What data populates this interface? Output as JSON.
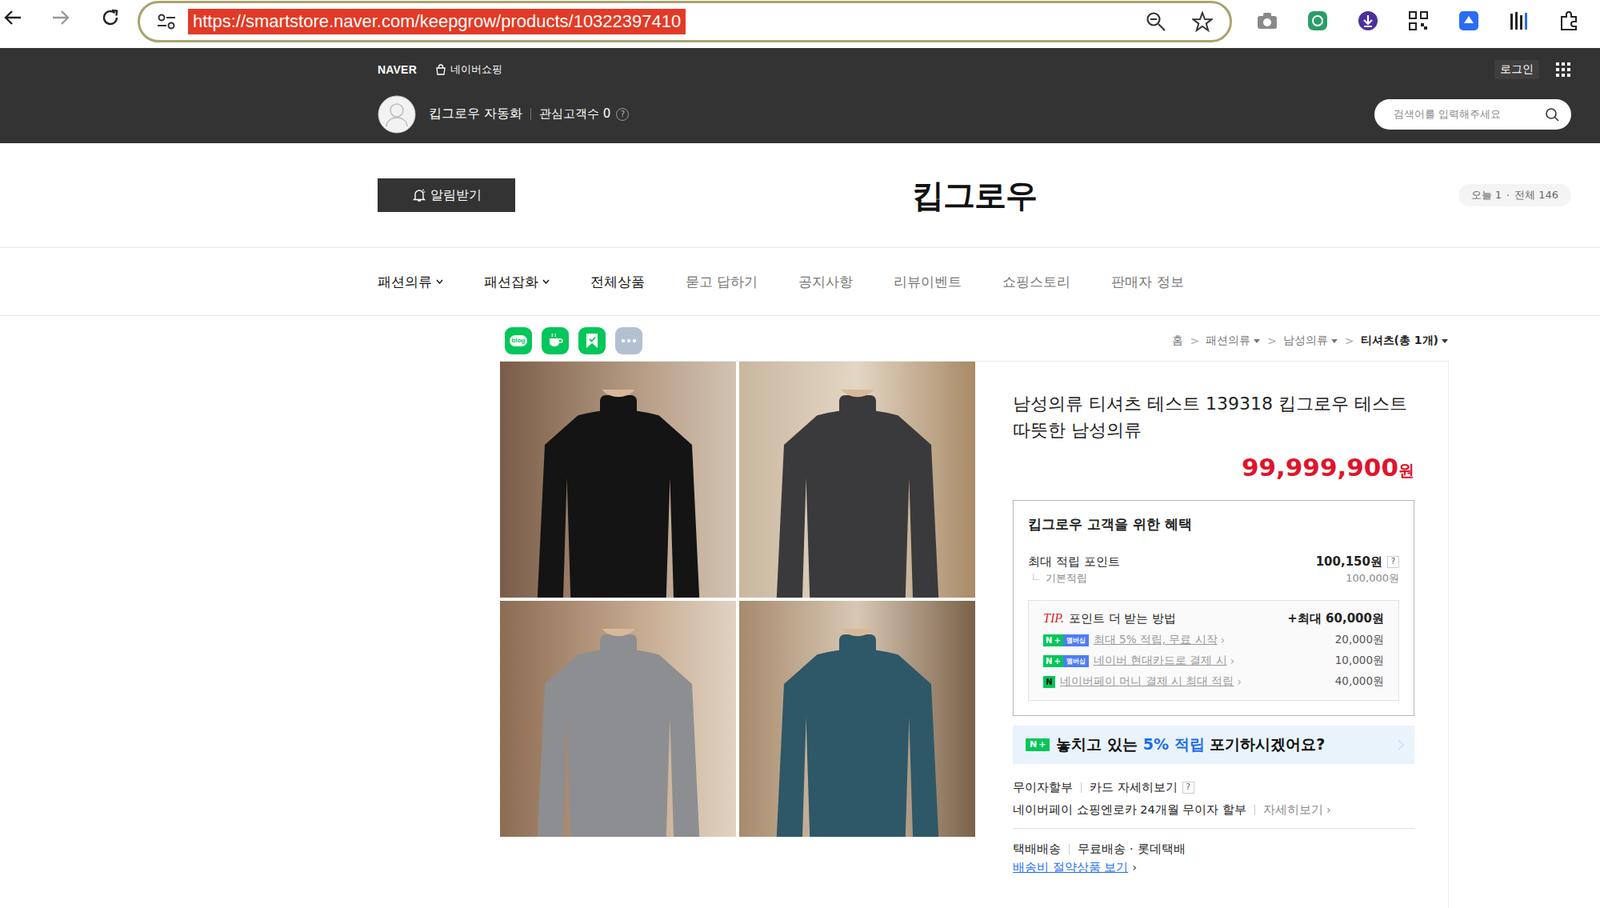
{
  "browser": {
    "url": "https://smartstore.naver.com/keepgrow/products/10322397410"
  },
  "gnb": {
    "logo": "NAVER",
    "shopping": "네이버쇼핑",
    "login": "로그인"
  },
  "store": {
    "name": "킵그로우 자동화",
    "followers": "관심고객수 0",
    "help": "?",
    "search_placeholder": "검색어를 입력해주세요"
  },
  "header": {
    "alarm": "알림받기",
    "title": "킵그로우",
    "today": "오늘 1",
    "dot": "·",
    "total": "전체 146"
  },
  "menu": [
    {
      "label": "패션의류",
      "kind": "category",
      "dropdown": true
    },
    {
      "label": "패션잡화",
      "kind": "category",
      "dropdown": true
    },
    {
      "label": "전체상품",
      "kind": "category",
      "dropdown": false
    },
    {
      "label": "묻고 답하기",
      "kind": "page",
      "dropdown": false
    },
    {
      "label": "공지사항",
      "kind": "page",
      "dropdown": false
    },
    {
      "label": "리뷰이벤트",
      "kind": "page",
      "dropdown": false
    },
    {
      "label": "쇼핑스토리",
      "kind": "page",
      "dropdown": false
    },
    {
      "label": "판매자 정보",
      "kind": "page",
      "dropdown": false
    }
  ],
  "share": [
    {
      "kind": "blog",
      "label": "blog"
    },
    {
      "kind": "cafe"
    },
    {
      "kind": "bookmark"
    },
    {
      "kind": "more"
    }
  ],
  "breadcrumb": {
    "separator": ">",
    "items": [
      {
        "label": "홈",
        "dropdown": false,
        "current": false
      },
      {
        "label": "패션의류",
        "dropdown": true,
        "current": false
      },
      {
        "label": "남성의류",
        "dropdown": true,
        "current": false
      },
      {
        "label": "티셔츠(총 1개)",
        "dropdown": true,
        "current": true
      }
    ]
  },
  "images": [
    {
      "color": "#141414"
    },
    {
      "color": "#3a3a3c"
    },
    {
      "color": "#8d8e91"
    },
    {
      "color": "#2e5868"
    }
  ],
  "product": {
    "title": "남성의류 티셔츠 테스트 139318 킵그로우 테스트 따뜻한 남성의류",
    "price": "99,999,900",
    "currency": "원"
  },
  "benefits": {
    "title": "킵그로우 고객을 위한 혜택",
    "max_label": "최대 적립 포인트",
    "max_value": "100,150원",
    "help": "?",
    "base_label": "기본적립",
    "base_value": "100,000원",
    "tip": {
      "tag": "TIP.",
      "label": "포인트 더 받는 방법",
      "total": "+최대 60,000원",
      "arrow": "›",
      "items": [
        {
          "kind": "membership",
          "n": "N",
          "plus": "+",
          "badge": "멤버십",
          "text": "최대 5% 적립, 무료 시작",
          "value": "20,000원"
        },
        {
          "kind": "membership",
          "n": "N",
          "plus": "+",
          "badge": "멤버십",
          "text": "네이버 현대카드로 결제 시",
          "value": "10,000원"
        },
        {
          "kind": "pay",
          "n": "N",
          "text": "네이버페이 머니 결제 시 최대 적립",
          "value": "40,000원"
        }
      ]
    }
  },
  "promo": {
    "n": "N",
    "plus": "+",
    "text_before": "놓치고 있는 ",
    "highlight": "5% 적립",
    "text_after": " 포기하시겠어요?"
  },
  "installment": {
    "label": "무이자할부",
    "card": "카드 자세히보기",
    "help": "?",
    "npay": "네이버페이 쇼핑엔로카 24개월 무이자 할부",
    "more": "자세히보기",
    "arrow": "›"
  },
  "shipping": {
    "method": "택배배송",
    "fee": "무료배송",
    "dot": "·",
    "carrier": "롯데택배",
    "link": "배송비 절약상품 보기",
    "arrow": "›"
  }
}
